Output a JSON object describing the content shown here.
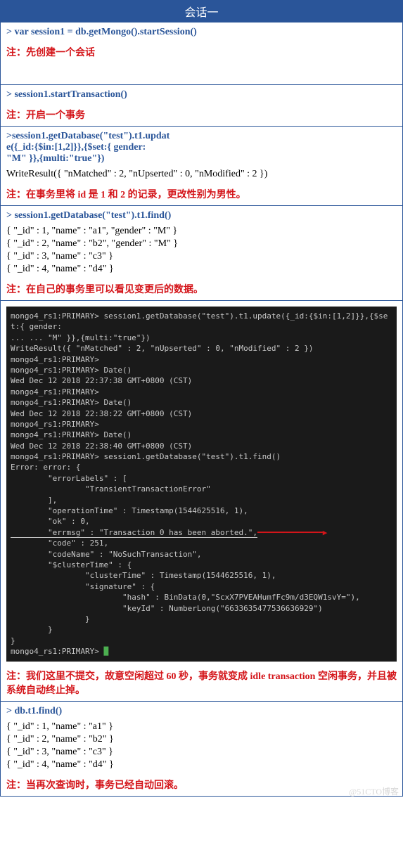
{
  "header": "会话一",
  "block1": {
    "cmd": "> var session1 = db.getMongo().startSession()",
    "note": "注：先创建一个会话"
  },
  "block2": {
    "cmd": "> session1.startTransaction()",
    "note": "注：开启一个事务"
  },
  "block3": {
    "cmd_l1": ">session1.getDatabase(\"test\").t1.updat",
    "cmd_l2": "e({_id:{$in:[1,2]}},{$set:{ gender:",
    "cmd_l3": "\"M\" }},{multi:\"true\"})",
    "result": "WriteResult({ \"nMatched\" : 2, \"nUpserted\" : 0, \"nModified\" : 2 })",
    "note": "注：在事务里将 id 是 1 和 2 的记录，更改性别为男性。"
  },
  "block4": {
    "cmd": "> session1.getDatabase(\"test\").t1.find()",
    "r1": "{ \"_id\" : 1, \"name\" : \"a1\", \"gender\" : \"M\" }",
    "r2": "{ \"_id\" : 2, \"name\" : \"b2\", \"gender\" : \"M\" }",
    "r3": "{ \"_id\" : 3, \"name\" : \"c3\" }",
    "r4": "{ \"_id\" : 4, \"name\" : \"d4\" }",
    "note": "注：在自己的事务里可以看见变更后的数据。"
  },
  "block5": {
    "terminal_lines": [
      "mongo4_rs1:PRIMARY> session1.getDatabase(\"test\").t1.update({_id:{$in:[1,2]}},{$set:{ gender:",
      "... ... \"M\" }},{multi:\"true\"})",
      "WriteResult({ \"nMatched\" : 2, \"nUpserted\" : 0, \"nModified\" : 2 })",
      "mongo4_rs1:PRIMARY>",
      "mongo4_rs1:PRIMARY> Date()",
      "Wed Dec 12 2018 22:37:38 GMT+0800 (CST)",
      "mongo4_rs1:PRIMARY>",
      "mongo4_rs1:PRIMARY> Date()",
      "Wed Dec 12 2018 22:38:22 GMT+0800 (CST)",
      "mongo4_rs1:PRIMARY>",
      "mongo4_rs1:PRIMARY> Date()",
      "Wed Dec 12 2018 22:38:40 GMT+0800 (CST)",
      "mongo4_rs1:PRIMARY> session1.getDatabase(\"test\").t1.find()",
      "Error: error: {",
      "        \"errorLabels\" : [",
      "                \"TransientTransactionError\"",
      "        ],",
      "        \"operationTime\" : Timestamp(1544625516, 1),",
      "        \"ok\" : 0,"
    ],
    "errmsg_line": "        \"errmsg\" : \"Transaction 0 has been aborted.\",",
    "terminal_lines2": [
      "        \"code\" : 251,",
      "        \"codeName\" : \"NoSuchTransaction\",",
      "        \"$clusterTime\" : {",
      "                \"clusterTime\" : Timestamp(1544625516, 1),",
      "                \"signature\" : {",
      "                        \"hash\" : BinData(0,\"ScxX7PVEAHumfFc9m/d3EQW1svY=\"),",
      "                        \"keyId\" : NumberLong(\"6633635477536636929\")",
      "                }",
      "        }",
      "}"
    ],
    "prompt_end": "mongo4_rs1:PRIMARY> ",
    "note": "注：我们这里不提交，故意空闲超过 60 秒，事务就变成 idle transaction 空闲事务，并且被系统自动终止掉。"
  },
  "block6": {
    "cmd": "> db.t1.find()",
    "r1": "{ \"_id\" : 1, \"name\" : \"a1\" }",
    "r2": "{ \"_id\" : 2, \"name\" : \"b2\" }",
    "r3": "{ \"_id\" : 3, \"name\" : \"c3\" }",
    "r4": "{ \"_id\" : 4, \"name\" : \"d4\" }",
    "note": "注：当再次查询时，事务已经自动回滚。"
  },
  "watermark": "@51CTO博客"
}
